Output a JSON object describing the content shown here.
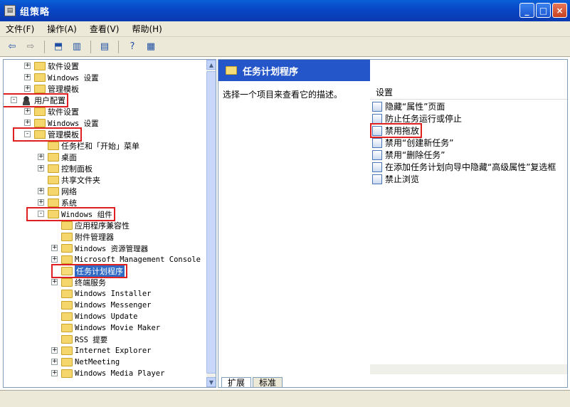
{
  "window": {
    "title": "组策略",
    "minimize": "_",
    "maximize": "□",
    "close": "×"
  },
  "menu": [
    "文件(F)",
    "操作(A)",
    "查看(V)",
    "帮助(H)"
  ],
  "tree": [
    {
      "label": "软件设置",
      "indent": 2,
      "exp": "+",
      "icon": "folder"
    },
    {
      "label": "Windows 设置",
      "indent": 2,
      "exp": "+",
      "icon": "folder",
      "mono": true
    },
    {
      "label": "管理模板",
      "indent": 2,
      "exp": "+",
      "icon": "folder"
    },
    {
      "label": "用户配置",
      "indent": 1,
      "exp": "-",
      "icon": "user",
      "boxed": true
    },
    {
      "label": "软件设置",
      "indent": 2,
      "exp": "+",
      "icon": "folder"
    },
    {
      "label": "Windows 设置",
      "indent": 2,
      "exp": "+",
      "icon": "folder",
      "mono": true
    },
    {
      "label": "管理模板",
      "indent": 2,
      "exp": "-",
      "icon": "folder",
      "boxed": true
    },
    {
      "label": "任务栏和「开始」菜单",
      "indent": 3,
      "exp": "",
      "icon": "folder"
    },
    {
      "label": "桌面",
      "indent": 3,
      "exp": "+",
      "icon": "folder"
    },
    {
      "label": "控制面板",
      "indent": 3,
      "exp": "+",
      "icon": "folder"
    },
    {
      "label": "共享文件夹",
      "indent": 3,
      "exp": "",
      "icon": "folder"
    },
    {
      "label": "网络",
      "indent": 3,
      "exp": "+",
      "icon": "folder"
    },
    {
      "label": "系统",
      "indent": 3,
      "exp": "+",
      "icon": "folder"
    },
    {
      "label": "Windows 组件",
      "indent": 3,
      "exp": "-",
      "icon": "folder",
      "boxed": true,
      "mono": true
    },
    {
      "label": "应用程序兼容性",
      "indent": 4,
      "exp": "",
      "icon": "folder"
    },
    {
      "label": "附件管理器",
      "indent": 4,
      "exp": "",
      "icon": "folder"
    },
    {
      "label": "Windows 资源管理器",
      "indent": 4,
      "exp": "+",
      "icon": "folder",
      "mono": true
    },
    {
      "label": "Microsoft Management Console",
      "indent": 4,
      "exp": "+",
      "icon": "folder",
      "mono": true
    },
    {
      "label": "任务计划程序",
      "indent": 4,
      "exp": "",
      "icon": "folder-open",
      "boxed": true,
      "selected": true
    },
    {
      "label": "终端服务",
      "indent": 4,
      "exp": "+",
      "icon": "folder"
    },
    {
      "label": "Windows Installer",
      "indent": 4,
      "exp": "",
      "icon": "folder",
      "mono": true
    },
    {
      "label": "Windows Messenger",
      "indent": 4,
      "exp": "",
      "icon": "folder",
      "mono": true
    },
    {
      "label": "Windows Update",
      "indent": 4,
      "exp": "",
      "icon": "folder",
      "mono": true
    },
    {
      "label": "Windows Movie Maker",
      "indent": 4,
      "exp": "",
      "icon": "folder",
      "mono": true
    },
    {
      "label": "RSS 提要",
      "indent": 4,
      "exp": "",
      "icon": "folder",
      "mono": true
    },
    {
      "label": "Internet Explorer",
      "indent": 4,
      "exp": "+",
      "icon": "folder",
      "mono": true
    },
    {
      "label": "NetMeeting",
      "indent": 4,
      "exp": "+",
      "icon": "folder",
      "mono": true
    },
    {
      "label": "Windows Media Player",
      "indent": 4,
      "exp": "+",
      "icon": "folder",
      "mono": true
    }
  ],
  "right": {
    "header": "任务计划程序",
    "description": "选择一个项目来查看它的描述。",
    "column": "设置",
    "policies": [
      {
        "label": "隐藏“属性”页面"
      },
      {
        "label": "防止任务运行或停止"
      },
      {
        "label": "禁用拖放",
        "boxed": true
      },
      {
        "label": "禁用“创建新任务”"
      },
      {
        "label": "禁用“删除任务”"
      },
      {
        "label": "在添加任务计划向导中隐藏“高级属性”复选框"
      },
      {
        "label": "禁止浏览"
      }
    ],
    "tabs": [
      "扩展",
      "标准"
    ]
  }
}
